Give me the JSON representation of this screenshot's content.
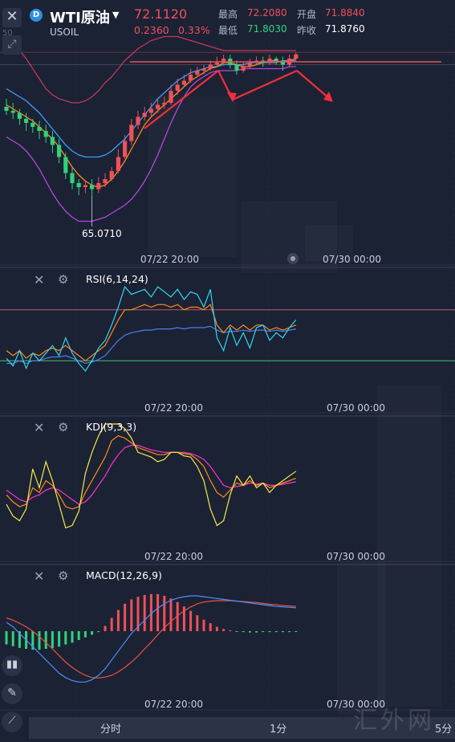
{
  "header": {
    "badge": "D",
    "title": "WTI原油",
    "symbol": "USOIL",
    "price": "72.1120",
    "change": "0.2360",
    "change_pct": "0.33%",
    "high_label": "最高",
    "high_value": "72.2080",
    "low_label": "最低",
    "low_value": "71.8030",
    "open_label": "开盘",
    "open_value": "71.8840",
    "prev_close_label": "昨收",
    "prev_close_value": "71.8760"
  },
  "main_chart": {
    "low_marker": "65.0710",
    "left_edge_label": "50"
  },
  "time_axis": {
    "label_1": "07/22 20:00",
    "label_2": "07/30 00:00"
  },
  "indicators": {
    "rsi_title": "RSI(6,14,24)",
    "kdj_title": "KDJ(9,3,3)",
    "macd_title": "MACD(12,26,9)"
  },
  "toolbar": {
    "timeshare": "分时",
    "one_min": "1分",
    "five_min": "5分"
  },
  "watermark": "汇外网",
  "colors": {
    "background": "#1b2234",
    "up": "#f0505a",
    "down": "#33d17a",
    "boll_upper": "#c2385a",
    "boll_mid": "#3aa0ff",
    "boll_lower": "#b845e0",
    "ma": "#ff8a1e",
    "rsi6": "#33d5f0",
    "rsi14": "#ff8a1e",
    "rsi24": "#4a7ff0",
    "kdj_k": "#ff8a1e",
    "kdj_d": "#ff33cc",
    "kdj_j": "#f5e84a",
    "dif": "#4a8fff",
    "dea": "#f05040"
  },
  "chart_data": [
    {
      "type": "candlestick",
      "title": "WTI原油 USOIL",
      "x_tick_labels": [
        "07/22 20:00",
        "07/30 00:00"
      ],
      "price_readout": 72.112,
      "day_high": 72.208,
      "day_low": 71.803,
      "marked_low": 65.071,
      "candles": [
        [
          69.5,
          69.3,
          69.9,
          69.1
        ],
        [
          69.3,
          69.2,
          69.7,
          68.9
        ],
        [
          69.2,
          68.9,
          69.4,
          68.6
        ],
        [
          68.9,
          68.7,
          69.2,
          68.3
        ],
        [
          68.7,
          68.5,
          68.9,
          68.2
        ],
        [
          68.5,
          68.3,
          68.8,
          67.9
        ],
        [
          68.3,
          68.0,
          68.6,
          67.7
        ],
        [
          68.0,
          67.6,
          68.3,
          67.2
        ],
        [
          67.6,
          67.0,
          67.9,
          66.7
        ],
        [
          67.0,
          66.2,
          67.2,
          65.9
        ],
        [
          66.2,
          65.7,
          66.5,
          65.4
        ],
        [
          65.7,
          65.5,
          65.9,
          65.1
        ],
        [
          65.5,
          65.6,
          65.8,
          65.2
        ],
        [
          65.6,
          65.4,
          65.9,
          65.07
        ],
        [
          65.4,
          65.7,
          66.0,
          65.2
        ],
        [
          65.7,
          65.9,
          66.2,
          65.5
        ],
        [
          65.9,
          66.3,
          66.5,
          65.8
        ],
        [
          66.3,
          67.0,
          67.4,
          66.2
        ],
        [
          67.0,
          67.8,
          68.1,
          66.9
        ],
        [
          67.8,
          68.6,
          68.9,
          67.6
        ],
        [
          68.6,
          69.0,
          69.3,
          68.4
        ],
        [
          69.0,
          69.2,
          69.5,
          68.8
        ],
        [
          69.2,
          69.4,
          69.7,
          69.0
        ],
        [
          69.4,
          69.6,
          69.9,
          69.2
        ],
        [
          69.6,
          69.7,
          70.0,
          69.4
        ],
        [
          69.7,
          70.3,
          70.6,
          69.6
        ],
        [
          70.3,
          70.6,
          70.9,
          70.1
        ],
        [
          70.6,
          70.8,
          71.1,
          70.5
        ],
        [
          70.8,
          71.1,
          71.4,
          70.7
        ],
        [
          71.1,
          71.3,
          71.5,
          71.0
        ],
        [
          71.3,
          71.4,
          71.6,
          71.1
        ],
        [
          71.4,
          71.6,
          71.8,
          71.3
        ],
        [
          71.6,
          71.7,
          72.0,
          71.5
        ],
        [
          71.7,
          71.9,
          72.1,
          71.6
        ],
        [
          71.9,
          71.6,
          72.1,
          71.4
        ],
        [
          71.6,
          71.3,
          71.8,
          71.1
        ],
        [
          71.3,
          71.5,
          71.7,
          71.2
        ],
        [
          71.5,
          71.7,
          71.9,
          71.4
        ],
        [
          71.7,
          71.8,
          72.0,
          71.6
        ],
        [
          71.8,
          71.7,
          72.0,
          71.5
        ],
        [
          71.7,
          71.9,
          72.1,
          71.6
        ],
        [
          71.9,
          71.8,
          72.0,
          71.6
        ],
        [
          71.8,
          71.6,
          72.0,
          71.3
        ],
        [
          71.6,
          71.9,
          72.1,
          71.5
        ],
        [
          71.9,
          72.11,
          72.21,
          71.8
        ]
      ],
      "boll_upper": [
        72.9,
        72.6,
        72.3,
        71.9,
        71.4,
        70.9,
        70.4,
        70.1,
        69.9,
        69.8,
        69.7,
        69.7,
        69.8,
        70.0,
        70.3,
        70.7,
        71.0,
        71.4,
        71.8,
        72.1,
        72.4,
        72.6,
        72.8,
        72.9,
        73.0,
        73.0,
        73.0,
        72.9,
        72.8,
        72.7,
        72.6,
        72.5,
        72.4,
        72.3,
        72.3,
        72.3,
        72.3,
        72.3,
        72.3,
        72.3,
        72.3,
        72.3,
        72.3,
        72.3,
        72.3
      ],
      "boll_mid": [
        70.4,
        70.2,
        70.0,
        69.8,
        69.5,
        69.2,
        68.8,
        68.4,
        68.0,
        67.6,
        67.3,
        67.1,
        67.0,
        67.0,
        67.0,
        67.1,
        67.3,
        67.6,
        67.9,
        68.3,
        68.7,
        69.1,
        69.5,
        69.9,
        70.2,
        70.5,
        70.8,
        71.0,
        71.2,
        71.3,
        71.4,
        71.5,
        71.5,
        71.6,
        71.6,
        71.6,
        71.6,
        71.7,
        71.7,
        71.7,
        71.7,
        71.7,
        71.8,
        71.8,
        71.8
      ],
      "boll_lower": [
        68.0,
        67.8,
        67.6,
        67.3,
        66.9,
        66.4,
        65.8,
        65.2,
        64.7,
        64.3,
        64.0,
        63.8,
        63.8,
        63.8,
        63.9,
        64.0,
        64.2,
        64.4,
        64.6,
        64.9,
        65.3,
        65.8,
        66.4,
        67.1,
        67.9,
        68.7,
        69.4,
        70.0,
        70.5,
        70.8,
        71.0,
        71.2,
        71.3,
        71.3,
        71.3,
        71.3,
        71.4,
        71.4,
        71.4,
        71.4,
        71.4,
        71.4,
        71.4,
        71.5,
        71.5
      ],
      "ma": [
        69.6,
        69.4,
        69.2,
        69.0,
        68.8,
        68.5,
        68.2,
        67.9,
        67.5,
        67.0,
        66.5,
        66.1,
        65.8,
        65.6,
        65.5,
        65.6,
        65.9,
        66.3,
        66.8,
        67.4,
        68.0,
        68.6,
        69.0,
        69.3,
        69.6,
        69.9,
        70.2,
        70.5,
        70.8,
        71.0,
        71.2,
        71.4,
        71.5,
        71.7,
        71.7,
        71.6,
        71.5,
        71.5,
        71.6,
        71.7,
        71.8,
        71.8,
        71.7,
        71.8,
        71.9
      ]
    },
    {
      "type": "line",
      "title": "RSI(6,14,24)",
      "x_tick_labels": [
        "07/22 20:00",
        "07/30 00:00"
      ],
      "series": [
        {
          "name": "RSI6",
          "values": [
            32,
            26,
            38,
            24,
            36,
            30,
            36,
            42,
            34,
            48,
            36,
            28,
            22,
            30,
            40,
            46,
            58,
            72,
            88,
            82,
            84,
            86,
            80,
            88,
            84,
            80,
            86,
            78,
            84,
            82,
            72,
            86,
            48,
            38,
            56,
            42,
            52,
            40,
            56,
            58,
            46,
            52,
            48,
            56,
            62
          ]
        },
        {
          "name": "RSI14",
          "values": [
            38,
            34,
            38,
            32,
            36,
            34,
            38,
            40,
            38,
            42,
            38,
            34,
            30,
            34,
            38,
            42,
            52,
            62,
            70,
            70,
            72,
            74,
            72,
            74,
            74,
            72,
            74,
            70,
            72,
            72,
            70,
            74,
            58,
            52,
            58,
            54,
            58,
            54,
            58,
            58,
            54,
            56,
            54,
            56,
            58
          ]
        },
        {
          "name": "RSI24",
          "values": [
            28,
            28,
            30,
            28,
            30,
            30,
            32,
            33,
            33,
            34,
            32,
            30,
            28,
            29,
            31,
            34,
            40,
            46,
            50,
            52,
            53,
            54,
            54,
            55,
            55,
            55,
            56,
            55,
            56,
            56,
            56,
            57,
            54,
            52,
            53,
            53,
            54,
            53,
            54,
            54,
            53,
            54,
            53,
            54,
            55
          ]
        }
      ],
      "reference_lines": [
        70,
        30
      ]
    },
    {
      "type": "line",
      "title": "KDJ(9,3,3)",
      "x_tick_labels": [
        "07/22 20:00",
        "07/30 00:00"
      ],
      "series": [
        {
          "name": "K",
          "values": [
            40,
            34,
            30,
            32,
            46,
            42,
            52,
            48,
            40,
            30,
            28,
            30,
            42,
            52,
            62,
            72,
            86,
            90,
            88,
            84,
            80,
            78,
            76,
            74,
            74,
            76,
            76,
            75,
            74,
            70,
            64,
            52,
            42,
            38,
            44,
            50,
            48,
            52,
            48,
            50,
            46,
            48,
            50,
            52,
            54
          ]
        },
        {
          "name": "D",
          "values": [
            44,
            40,
            36,
            34,
            38,
            40,
            44,
            46,
            44,
            40,
            36,
            32,
            34,
            40,
            48,
            56,
            66,
            74,
            80,
            82,
            82,
            80,
            78,
            77,
            76,
            76,
            76,
            76,
            75,
            73,
            70,
            64,
            56,
            48,
            46,
            47,
            48,
            50,
            49,
            50,
            48,
            48,
            49,
            50,
            51
          ]
        },
        {
          "name": "J",
          "values": [
            32,
            22,
            18,
            28,
            62,
            46,
            68,
            52,
            32,
            12,
            14,
            26,
            58,
            76,
            90,
            100,
            100,
            100,
            96,
            88,
            76,
            74,
            72,
            68,
            70,
            76,
            76,
            73,
            72,
            64,
            52,
            28,
            14,
            18,
            40,
            56,
            48,
            56,
            46,
            50,
            42,
            48,
            52,
            56,
            60
          ]
        }
      ]
    },
    {
      "type": "bar",
      "title": "MACD(12,26,9)",
      "x_tick_labels": [
        "07/22 20:00",
        "07/30 00:00"
      ],
      "histogram": [
        -0.3,
        -0.34,
        -0.38,
        -0.4,
        -0.42,
        -0.42,
        -0.4,
        -0.38,
        -0.35,
        -0.3,
        -0.26,
        -0.2,
        -0.14,
        -0.08,
        -0.02,
        0.12,
        0.3,
        0.48,
        0.62,
        0.72,
        0.78,
        0.82,
        0.84,
        0.84,
        0.8,
        0.74,
        0.66,
        0.56,
        0.46,
        0.36,
        0.26,
        0.18,
        0.1,
        0.05,
        0.02,
        -0.01,
        -0.02,
        -0.03,
        -0.03,
        -0.02,
        -0.02,
        -0.02,
        -0.02,
        -0.02,
        -0.01
      ],
      "series": [
        {
          "name": "DIF",
          "values": [
            0.2,
            0.1,
            -0.05,
            -0.2,
            -0.35,
            -0.5,
            -0.65,
            -0.8,
            -0.95,
            -1.05,
            -1.12,
            -1.15,
            -1.15,
            -1.1,
            -1.0,
            -0.85,
            -0.65,
            -0.45,
            -0.25,
            -0.05,
            0.1,
            0.25,
            0.4,
            0.52,
            0.62,
            0.7,
            0.75,
            0.78,
            0.8,
            0.8,
            0.78,
            0.76,
            0.74,
            0.72,
            0.7,
            0.68,
            0.66,
            0.64,
            0.62,
            0.6,
            0.58,
            0.56,
            0.55,
            0.54,
            0.53
          ]
        },
        {
          "name": "DEA",
          "values": [
            0.3,
            0.25,
            0.18,
            0.1,
            0.0,
            -0.12,
            -0.26,
            -0.4,
            -0.55,
            -0.7,
            -0.82,
            -0.92,
            -1.0,
            -1.05,
            -1.06,
            -1.04,
            -1.0,
            -0.92,
            -0.82,
            -0.7,
            -0.56,
            -0.4,
            -0.25,
            -0.08,
            0.08,
            0.22,
            0.35,
            0.46,
            0.55,
            0.62,
            0.66,
            0.68,
            0.69,
            0.69,
            0.69,
            0.68,
            0.67,
            0.66,
            0.65,
            0.63,
            0.61,
            0.6,
            0.58,
            0.57,
            0.56
          ]
        }
      ]
    }
  ]
}
